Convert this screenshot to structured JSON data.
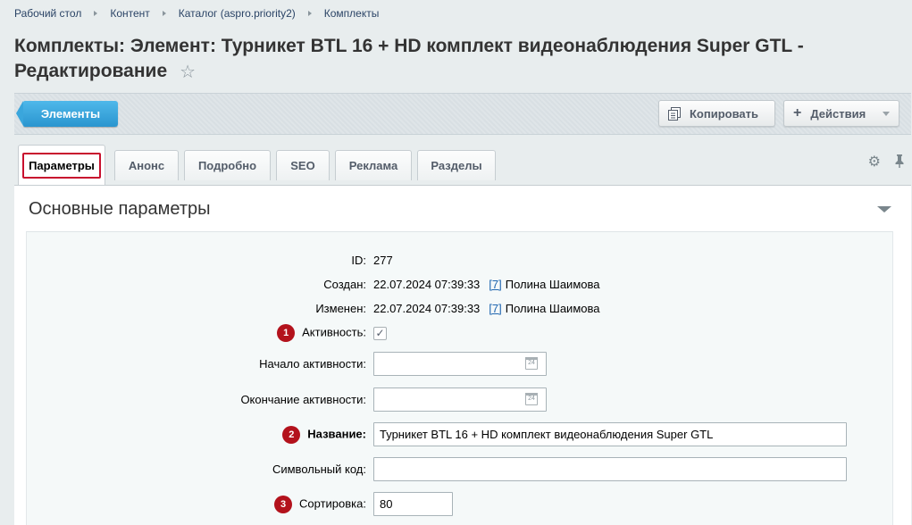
{
  "breadcrumbs": [
    "Рабочий стол",
    "Контент",
    "Каталог (aspro.priority2)",
    "Комплекты"
  ],
  "page": {
    "title": "Комплекты: Элемент: Турникет BTL 16 + HD комплект видеонаблюдения Super GTL - Редактирование"
  },
  "toolbar": {
    "elements_label": "Элементы",
    "copy_label": "Копировать",
    "actions_label": "Действия"
  },
  "tabs": [
    {
      "label": "Параметры",
      "active": true
    },
    {
      "label": "Анонс"
    },
    {
      "label": "Подробно"
    },
    {
      "label": "SEO"
    },
    {
      "label": "Реклама"
    },
    {
      "label": "Разделы"
    }
  ],
  "section": {
    "title": "Основные параметры"
  },
  "fields": {
    "id": {
      "label": "ID:",
      "value": "277"
    },
    "created": {
      "label": "Создан:",
      "date": "22.07.2024 07:39:33",
      "user_id": "[7]",
      "user_name": "Полина Шаимова"
    },
    "modified": {
      "label": "Изменен:",
      "date": "22.07.2024 07:39:33",
      "user_id": "[7]",
      "user_name": "Полина Шаимова"
    },
    "active": {
      "badge": "1",
      "label": "Активность:",
      "checked": true
    },
    "active_from": {
      "label": "Начало активности:",
      "value": ""
    },
    "active_to": {
      "label": "Окончание активности:",
      "value": ""
    },
    "name": {
      "badge": "2",
      "label": "Название:",
      "value": "Турникет BTL 16 + HD комплект видеонаблюдения Super GTL"
    },
    "code": {
      "label": "Символьный код:",
      "value": ""
    },
    "sort": {
      "badge": "3",
      "label": "Сортировка:",
      "value": "80"
    }
  },
  "colors": {
    "accent_blue": "#2a95cf",
    "badge_red": "#b3121c",
    "highlight_red": "#c8102e"
  }
}
